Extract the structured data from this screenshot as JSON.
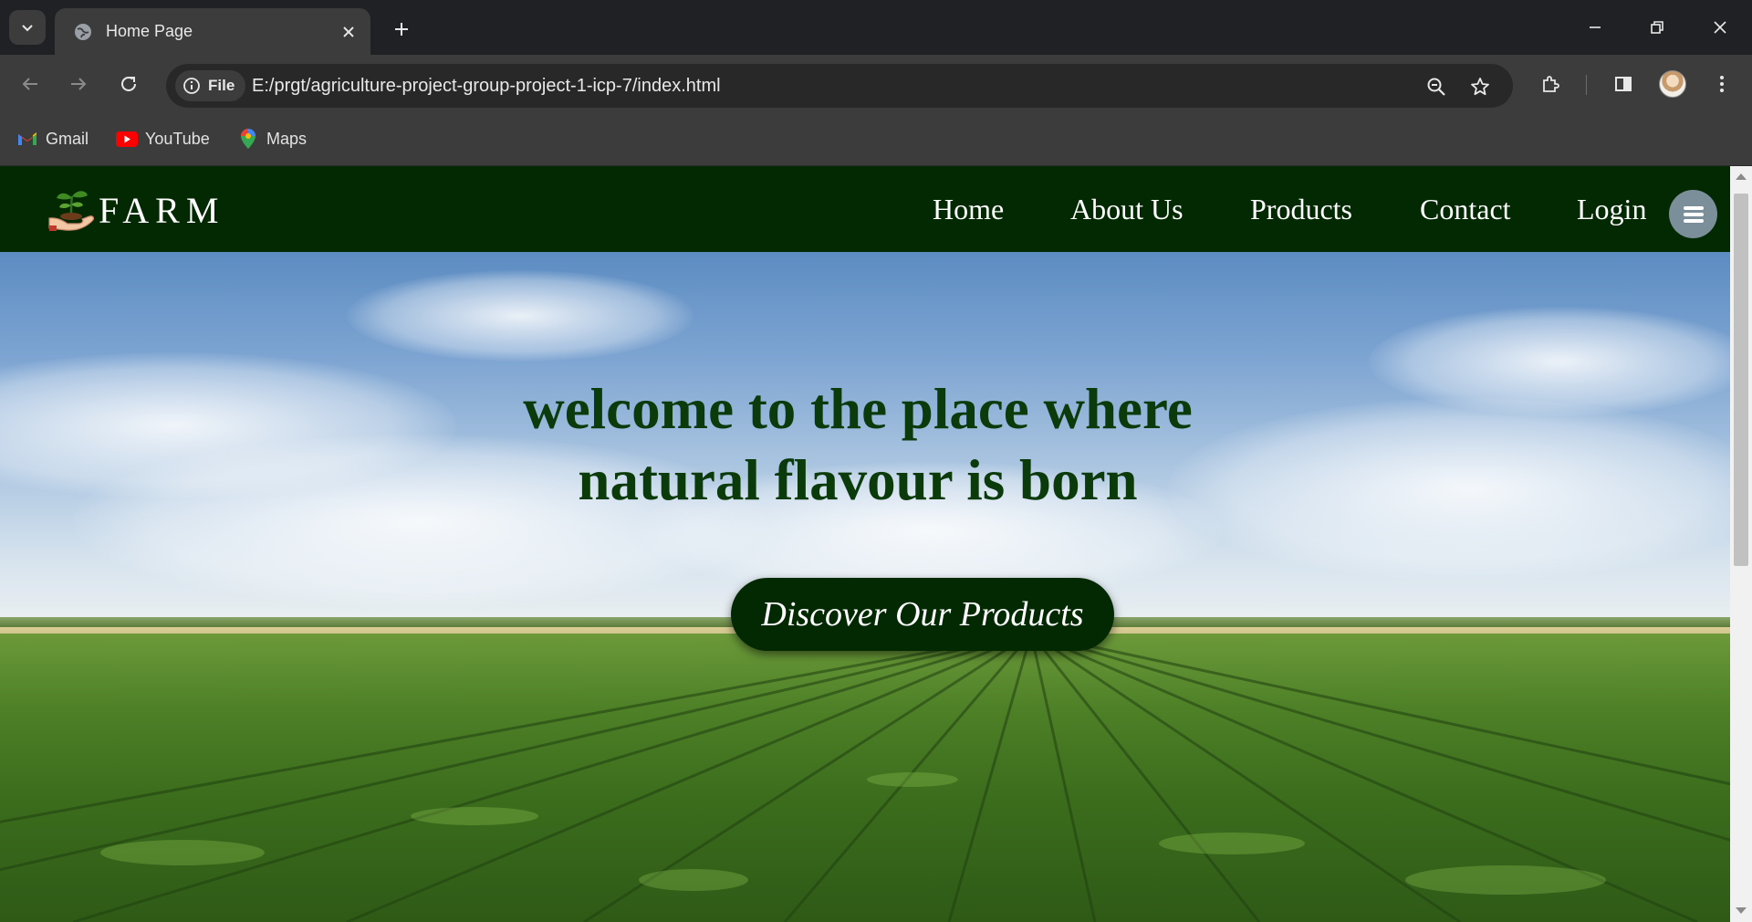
{
  "browser": {
    "tab": {
      "title": "Home Page"
    },
    "address_bar": {
      "chip_label": "File",
      "url": "E:/prgt/agriculture-project-group-project-1-icp-7/index.html"
    },
    "bookmarks": [
      {
        "label": "Gmail",
        "icon": "gmail-icon"
      },
      {
        "label": "YouTube",
        "icon": "youtube-icon"
      },
      {
        "label": "Maps",
        "icon": "maps-icon"
      }
    ]
  },
  "site": {
    "logo_text": "FARM",
    "nav": [
      "Home",
      "About Us",
      "Products",
      "Contact",
      "Login"
    ],
    "hero": {
      "heading_line1": "welcome to the place where",
      "heading_line2": "natural flavour is born",
      "cta_label": "Discover Our Products"
    }
  },
  "colors": {
    "nav_bg": "#022902",
    "heading": "#0b3a0b",
    "cta_bg": "#022902",
    "chrome_bg": "#3c3c3c"
  }
}
